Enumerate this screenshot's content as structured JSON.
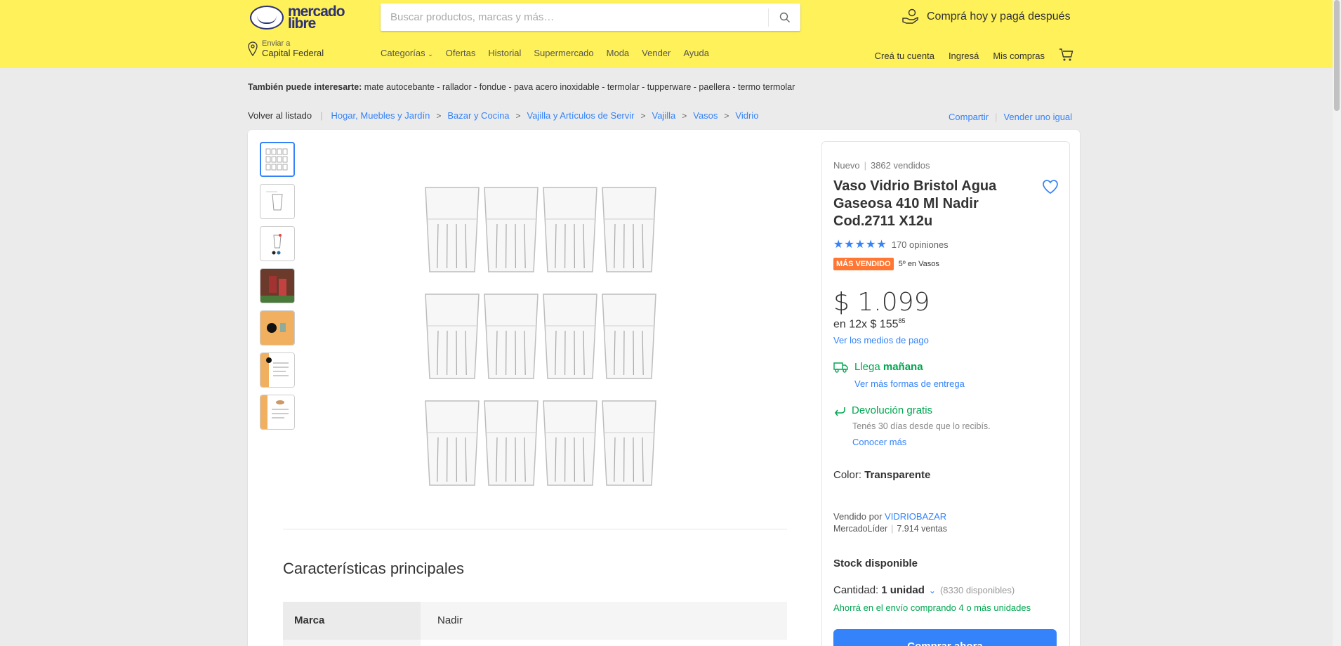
{
  "header": {
    "logo_line1": "mercado",
    "logo_line2": "libre",
    "search_placeholder": "Buscar productos, marcas y más…",
    "promo": "Comprá hoy y pagá después",
    "ship_to_label": "Enviar a",
    "ship_to_location": "Capital Federal",
    "nav": [
      "Categorías",
      "Ofertas",
      "Historial",
      "Supermercado",
      "Moda",
      "Vender",
      "Ayuda"
    ],
    "user_links": [
      "Creá tu cuenta",
      "Ingresá",
      "Mis compras"
    ],
    "brand_color": "#fff159"
  },
  "interest": {
    "label": "También puede interesarte:",
    "items": "mate autocebante - rallador - fondue - pava acero inoxidable - termolar - tupperware - paellera - termo termolar"
  },
  "breadcrumb": {
    "back": "Volver al listado",
    "items": [
      "Hogar, Muebles y Jardín",
      "Bazar y Cocina",
      "Vajilla y Artículos de Servir",
      "Vajilla",
      "Vasos",
      "Vidrio"
    ],
    "share": "Compartir",
    "sell_same": "Vender uno igual"
  },
  "gallery": {
    "thumb_icons": [
      "glasses-grid-thumb",
      "single-glass-thumb",
      "glass-dots-thumb",
      "drink-photo-thumb",
      "orange-logo-thumb",
      "spec-sheet-thumb",
      "spec-sheet-thumb-2"
    ]
  },
  "features": {
    "title": "Características principales",
    "rows": [
      {
        "key": "Marca",
        "value": "Nadir"
      }
    ]
  },
  "product": {
    "condition": "Nuevo",
    "sold": "3862 vendidos",
    "title": "Vaso Vidrio Bristol Agua Gaseosa 410 Ml Nadir Cod.2711 X12u",
    "rating_stars": 5,
    "reviews": "170 opiniones",
    "badge": "MÁS VENDIDO",
    "rank": "5º en Vasos",
    "price": "$ 1.099",
    "installments_prefix": "en 12x $ 155",
    "installments_cents": "85",
    "payment_link": "Ver los medios de pago",
    "shipping_prefix": "Llega",
    "shipping_bold": "mañana",
    "shipping_link": "Ver más formas de entrega",
    "return_title": "Devolución gratis",
    "return_desc": "Tenés 30 días desde que lo recibís.",
    "return_link": "Conocer más",
    "color_label": "Color:",
    "color_value": "Transparente",
    "seller_label": "Vendido por",
    "seller_name": "VIDRIOBAZAR",
    "seller_level": "MercadoLíder",
    "seller_sales": "7.914 ventas",
    "stock": "Stock disponible",
    "qty_label": "Cantidad:",
    "qty_value": "1 unidad",
    "qty_available": "(8330 disponibles)",
    "savings": "Ahorrá en el envío comprando 4 o más unidades",
    "buy_button": "Comprar ahora",
    "accent_color": "#3483fa",
    "green_color": "#00a650",
    "badge_color": "#ff7733"
  }
}
